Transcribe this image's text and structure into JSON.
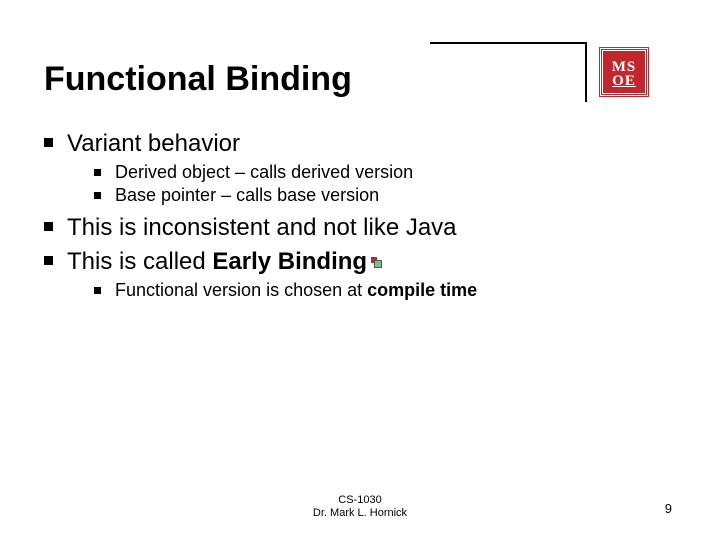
{
  "logo": {
    "line1": "MS",
    "line2": "OE"
  },
  "title": "Functional Binding",
  "bullets": {
    "b1": {
      "text": "Variant behavior",
      "sub": [
        "Derived object – calls derived version",
        "Base pointer – calls base version"
      ]
    },
    "b2": {
      "pre": "This is inconsistent and ",
      "em": "not like Java"
    },
    "b3": {
      "pre": "This is called ",
      "bold": "Early Binding",
      "sub_pre": "Functional version is chosen at ",
      "sub_bold": "compile time"
    }
  },
  "footer": {
    "course": "CS-1030",
    "author": "Dr. Mark L. Hornick"
  },
  "page_number": "9"
}
